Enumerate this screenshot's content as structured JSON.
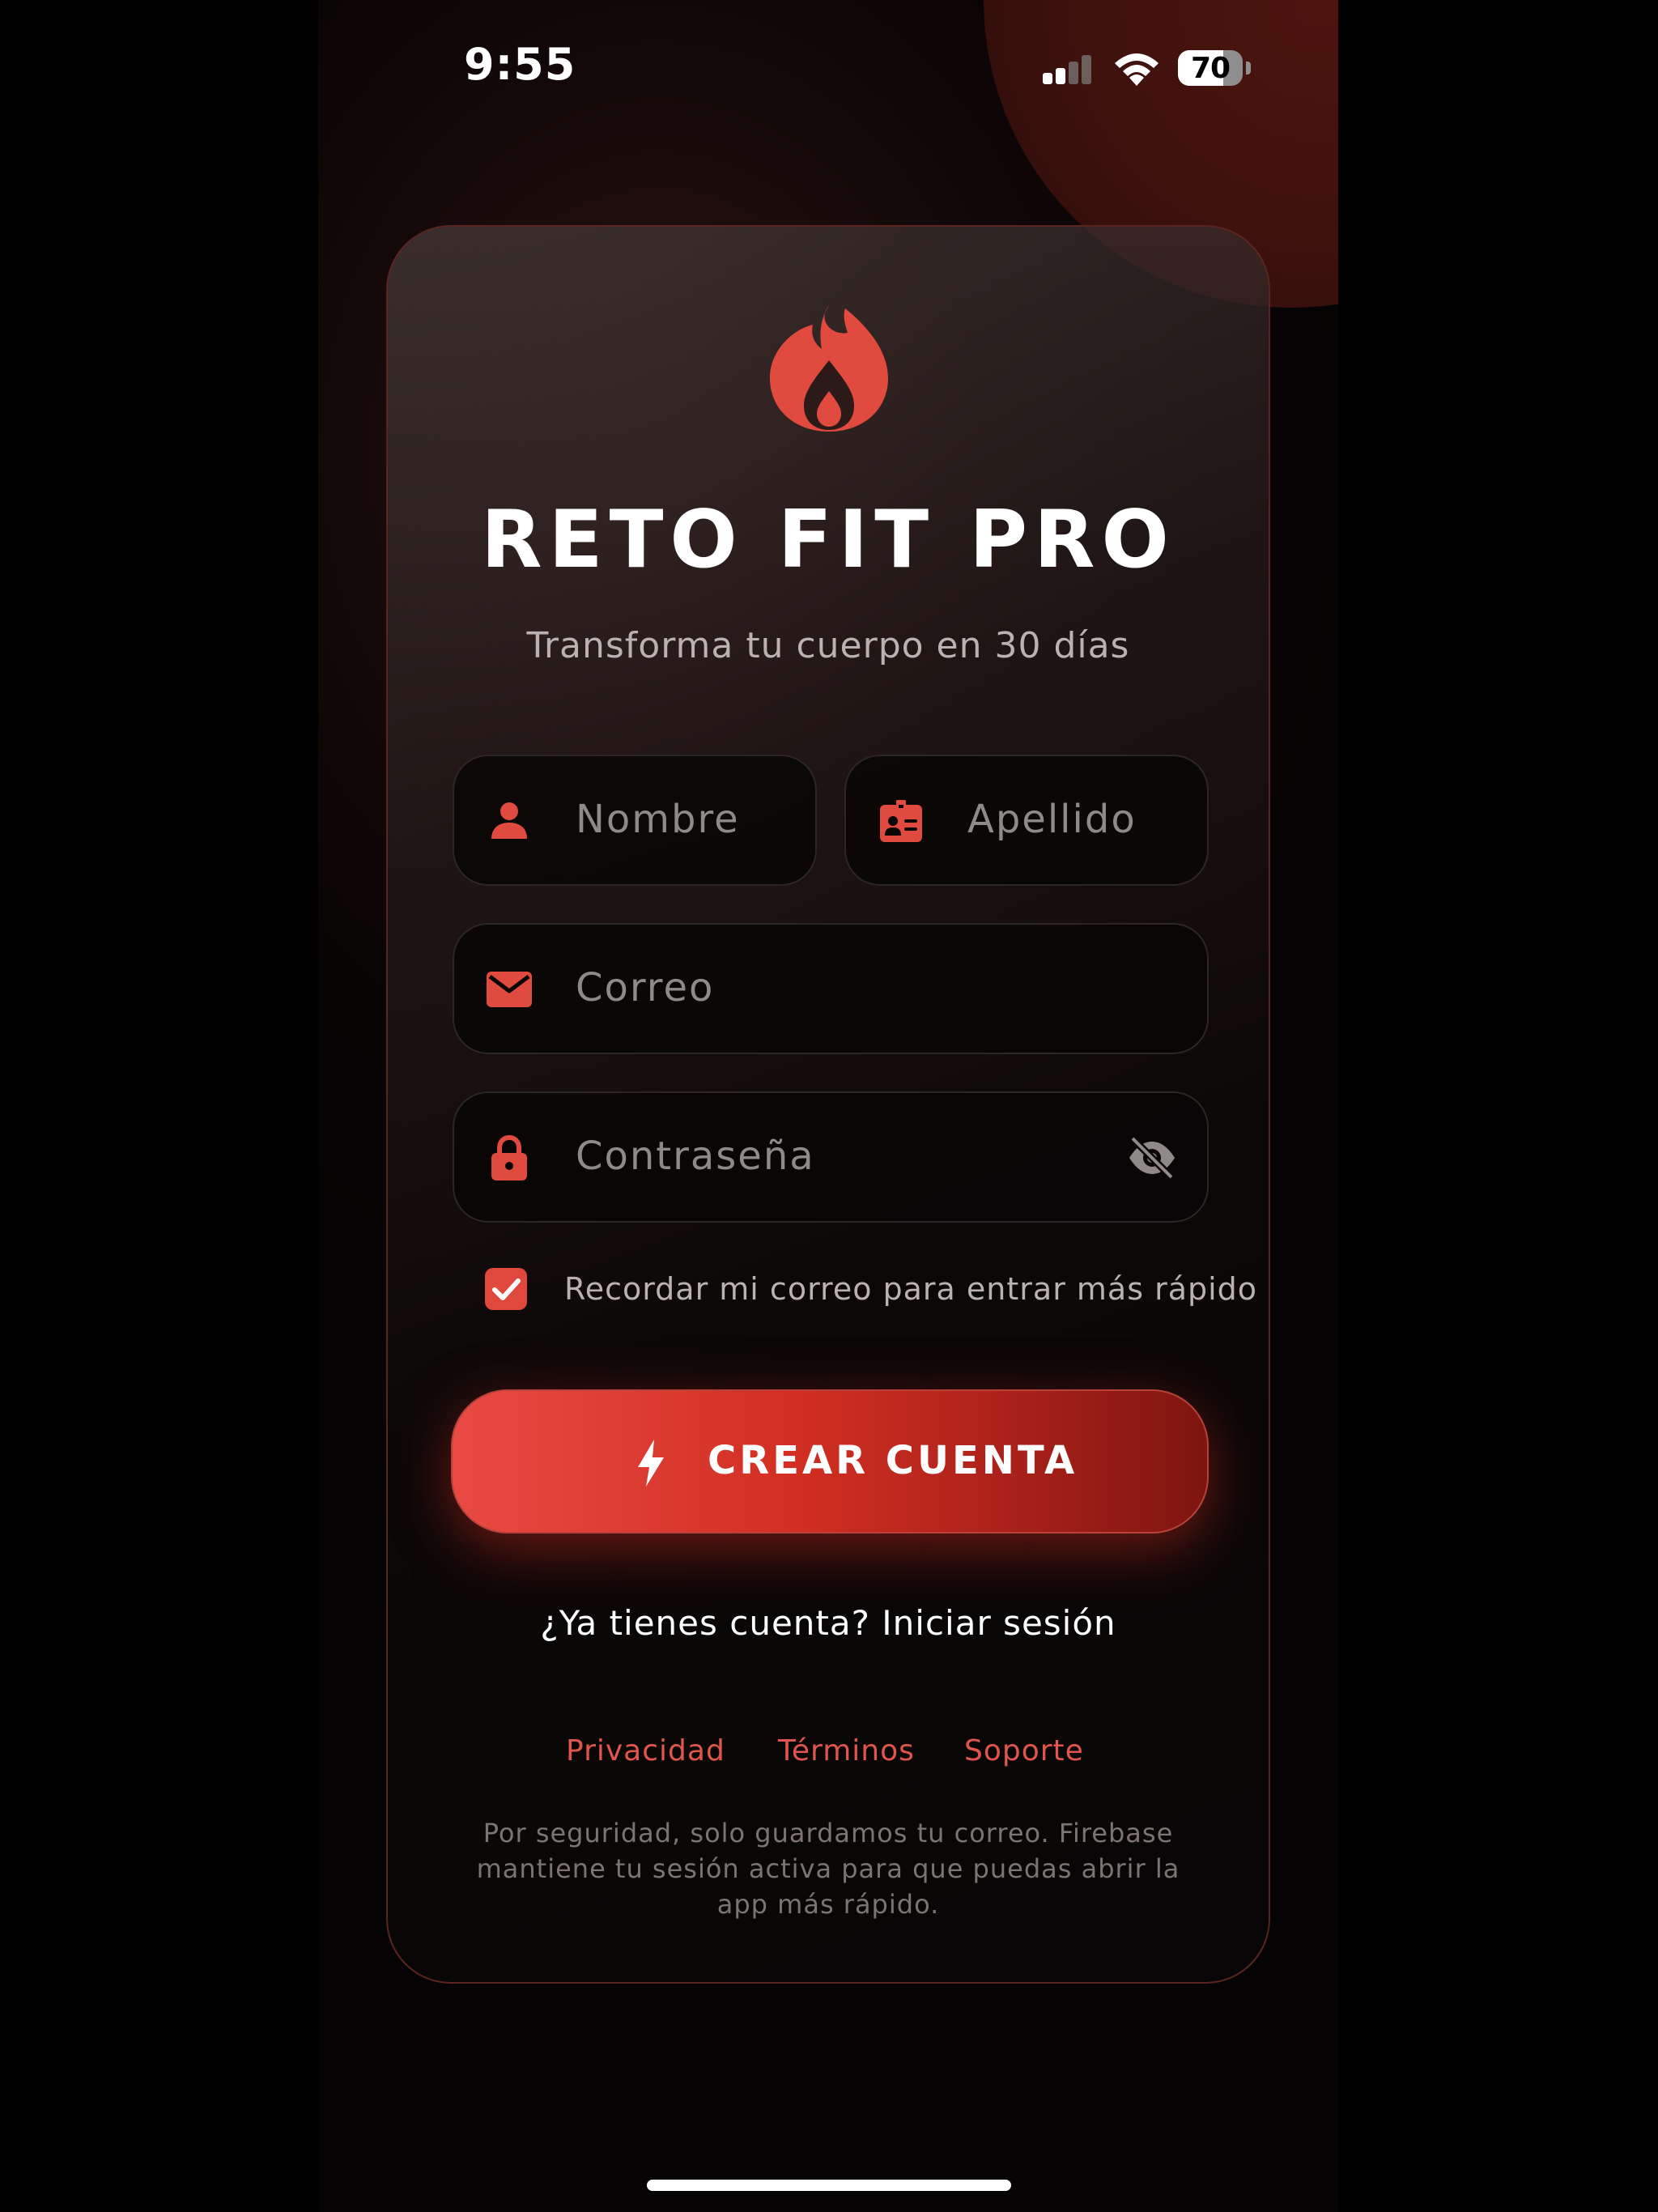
{
  "status_bar": {
    "time": "9:55",
    "battery": "70"
  },
  "brand": {
    "title": "RETO FIT PRO",
    "subtitle": "Transforma tu cuerpo en 30 días",
    "accent": "#e0483d"
  },
  "form": {
    "first_name_placeholder": "Nombre",
    "last_name_placeholder": "Apellido",
    "email_placeholder": "Correo",
    "password_placeholder": "Contraseña",
    "remember_label": "Recordar mi correo para entrar más rápido",
    "remember_checked": true,
    "submit_label": "CREAR CUENTA"
  },
  "login_prompt": "¿Ya tienes cuenta? Iniciar sesión",
  "footer": {
    "links": [
      "Privacidad",
      "Términos",
      "Soporte"
    ],
    "disclaimer": "Por seguridad, solo guardamos tu correo. Firebase mantiene tu sesión activa para que puedas abrir la app más rápido."
  },
  "icons": [
    "flame-icon",
    "person-icon",
    "id-card-icon",
    "envelope-icon",
    "lock-icon",
    "eye-slash-icon",
    "check-icon",
    "bolt-icon"
  ]
}
